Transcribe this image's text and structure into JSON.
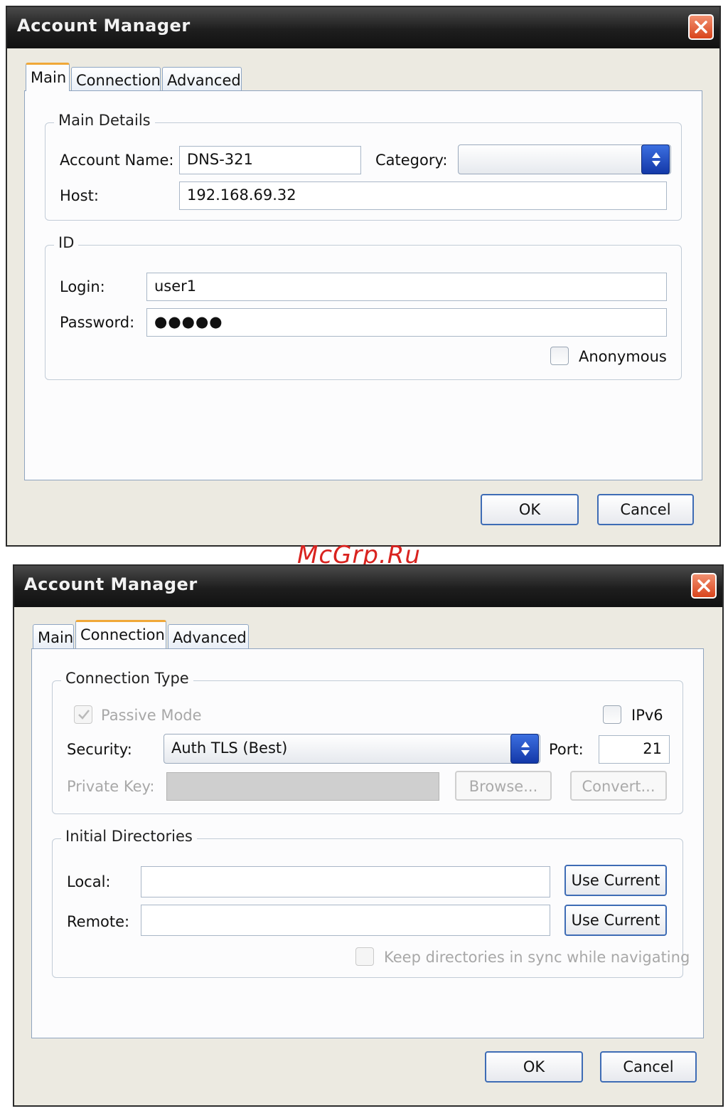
{
  "watermark": "McGrp.Ru",
  "dialog1": {
    "title": "Account Manager",
    "tabs": [
      "Main",
      "Connection",
      "Advanced"
    ],
    "main_details": {
      "legend": "Main Details",
      "account_name_label": "Account Name:",
      "account_name_value": "DNS-321",
      "category_label": "Category:",
      "category_value": "",
      "host_label": "Host:",
      "host_value": "192.168.69.32"
    },
    "id": {
      "legend": "ID",
      "login_label": "Login:",
      "login_value": "user1",
      "password_label": "Password:",
      "password_value": "●●●●●",
      "anonymous_label": "Anonymous",
      "anonymous_checked": false
    },
    "ok_label": "OK",
    "cancel_label": "Cancel"
  },
  "dialog2": {
    "title": "Account Manager",
    "tabs": [
      "Main",
      "Connection",
      "Advanced"
    ],
    "connection_type": {
      "legend": "Connection Type",
      "passive_mode_label": "Passive Mode",
      "passive_mode_checked": true,
      "ipv6_label": "IPv6",
      "ipv6_checked": false,
      "security_label": "Security:",
      "security_value": "Auth TLS (Best)",
      "port_label": "Port:",
      "port_value": "21",
      "private_key_label": "Private Key:",
      "private_key_value": "",
      "browse_label": "Browse...",
      "convert_label": "Convert..."
    },
    "initial_directories": {
      "legend": "Initial Directories",
      "local_label": "Local:",
      "local_value": "",
      "remote_label": "Remote:",
      "remote_value": "",
      "use_current_label": "Use Current",
      "keep_sync_label": "Keep directories in sync while navigating",
      "keep_sync_checked": false
    },
    "ok_label": "OK",
    "cancel_label": "Cancel"
  },
  "colors": {
    "titlebar": "#1e1e1e",
    "close_button": "#d8441c",
    "button_border": "#3e6cb5",
    "active_tab_accent": "#f0a838",
    "watermark": "#d9231f"
  }
}
